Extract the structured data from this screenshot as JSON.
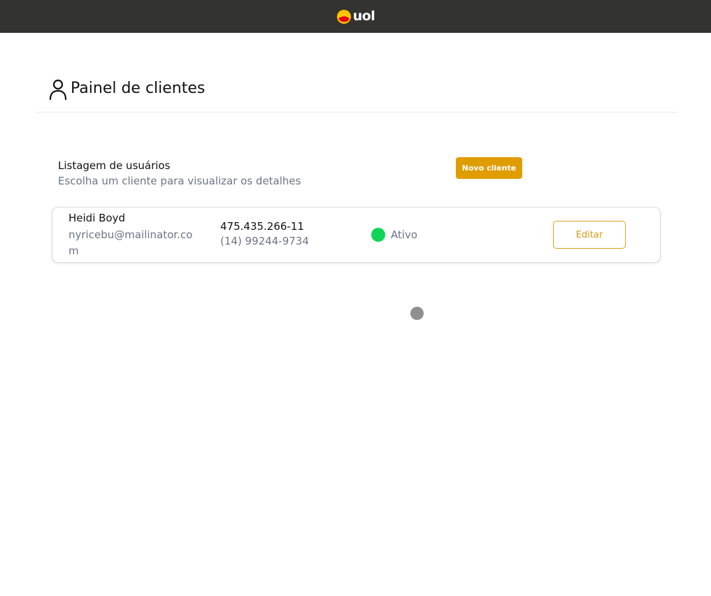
{
  "header": {
    "logo_text": "uol",
    "logo_colors": {
      "yellow": "#ffc400",
      "red": "#e3001b",
      "background": "#333331"
    }
  },
  "page": {
    "title": "Painel de clientes",
    "icon": "user-icon"
  },
  "list": {
    "title": "Listagem de usuários",
    "subtitle": "Escolha um cliente para visualizar os detalhes",
    "new_button_label": "Novo cliente",
    "accent_color": "#e09d00"
  },
  "clients": [
    {
      "name": "Heidi Boyd",
      "email": "nyricebu@mailinator.com",
      "cpf": "475.435.266-11",
      "phone": "(14) 99244-9734",
      "status": "Ativo",
      "status_color": "#0fd458",
      "edit_label": "Editar"
    }
  ],
  "loading_indicator": "spinner"
}
